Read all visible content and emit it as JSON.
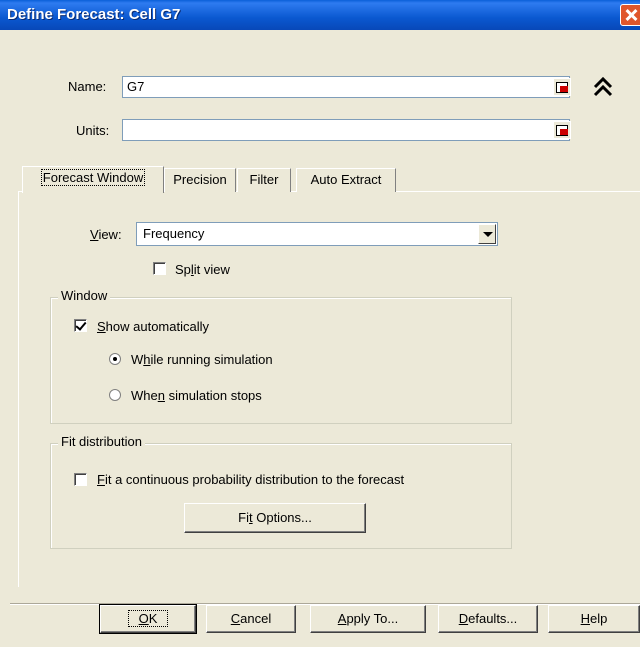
{
  "window": {
    "title": "Define Forecast: Cell G7"
  },
  "name_field": {
    "label": "Name:",
    "value": "G7"
  },
  "units_field": {
    "label": "Units:",
    "value": ""
  },
  "tabs": [
    {
      "label": "Forecast Window",
      "active": true
    },
    {
      "label": "Precision",
      "active": false
    },
    {
      "label": "Filter",
      "active": false
    },
    {
      "label": "Auto Extract",
      "active": false
    }
  ],
  "view": {
    "label": "View:",
    "selected": "Frequency"
  },
  "split_view": {
    "label": "Split view",
    "checked": false
  },
  "window_group": {
    "legend": "Window",
    "show_automatically": {
      "label": "Show automatically",
      "checked": true
    },
    "radio_running": {
      "label": "While running simulation",
      "selected": true
    },
    "radio_stops": {
      "label": "When simulation stops",
      "selected": false
    }
  },
  "fit_group": {
    "legend": "Fit distribution",
    "fit_checkbox": {
      "label": "Fit a continuous probability distribution to the forecast",
      "checked": false
    },
    "fit_options_button": "Fit Options..."
  },
  "buttons": {
    "ok": "OK",
    "cancel": "Cancel",
    "apply_to": "Apply To...",
    "defaults": "Defaults...",
    "help": "Help"
  },
  "icons": {
    "close": "close-icon",
    "cell_select": "cell-select-icon",
    "collapse": "collapse-up-icon"
  }
}
